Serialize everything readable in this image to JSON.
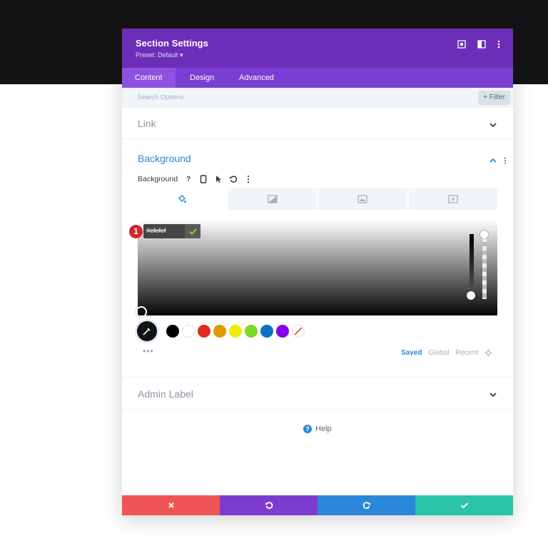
{
  "header": {
    "title": "Section Settings",
    "preset": "Preset: Default ▾"
  },
  "tabs": [
    {
      "label": "Content"
    },
    {
      "label": "Design"
    },
    {
      "label": "Advanced"
    }
  ],
  "search": {
    "placeholder": "Search Options",
    "filter_label": "+ Filter"
  },
  "sections": {
    "link": "Link",
    "background": "Background",
    "admin_label": "Admin Label"
  },
  "background": {
    "label": "Background",
    "hex_value": "#efefef",
    "annotation_number": "1",
    "swatches": [
      "#000000",
      "#ffffff",
      "#e02b20",
      "#e09900",
      "#edf000",
      "#7cda24",
      "#0c71c3",
      "#8300e9"
    ],
    "palette_tabs": {
      "saved": "Saved",
      "global": "Global",
      "recent": "Recent"
    },
    "more": "•••"
  },
  "help": {
    "label": "Help"
  },
  "colors": {
    "header": "#6c2eb9",
    "accent": "#2b87da",
    "cancel": "#ef5555",
    "undo": "#7e3bd0",
    "redo": "#2b87da",
    "save": "#29c4a9"
  }
}
